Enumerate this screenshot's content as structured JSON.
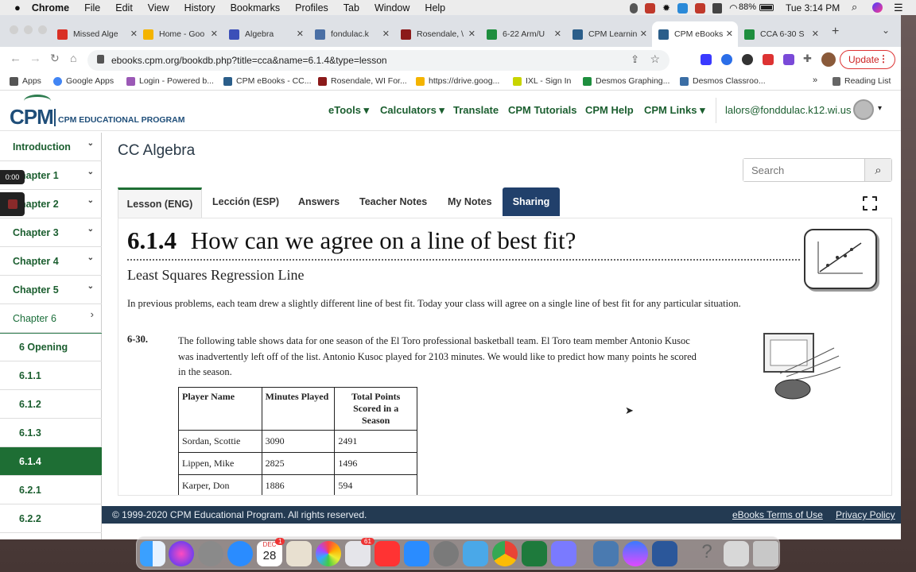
{
  "menubar": {
    "apple": "",
    "app": "Chrome",
    "menus": [
      "File",
      "Edit",
      "View",
      "History",
      "Bookmarks",
      "Profiles",
      "Tab",
      "Window",
      "Help"
    ],
    "battery": "88%",
    "clock": "Tue 3:14 PM"
  },
  "tabs": [
    {
      "label": "Missed Alge",
      "color": "#d93025"
    },
    {
      "label": "Home - Goo",
      "color": "#f4b400"
    },
    {
      "label": "Algebra",
      "color": "#3c4fb8"
    },
    {
      "label": "fondulac.k",
      "color": "#4a6fa5"
    },
    {
      "label": "Rosendale, \\",
      "color": "#8b1a1a"
    },
    {
      "label": "6-22 Arm/U",
      "color": "#1e8e3e"
    },
    {
      "label": "CPM Learnin",
      "color": "#2b5e8a"
    },
    {
      "label": "CPM eBooks",
      "color": "#2b5e8a"
    },
    {
      "label": "CCA 6-30 S",
      "color": "#1e8e3e"
    }
  ],
  "new_tab": "+",
  "address": {
    "url": "ebooks.cpm.org/bookdb.php?title=cca&name=6.1.4&type=lesson",
    "update_label": "Update"
  },
  "bookmarks": [
    {
      "label": "Apps",
      "color": "#555"
    },
    {
      "label": "Google Apps",
      "color": "#4285f4"
    },
    {
      "label": "Login - Powered b...",
      "color": "#9b59b6"
    },
    {
      "label": "CPM eBooks - CC...",
      "color": "#2b5e8a"
    },
    {
      "label": "Rosendale, WI For...",
      "color": "#8b1a1a"
    },
    {
      "label": "https://drive.goog...",
      "color": "#f4b400"
    },
    {
      "label": "IXL - Sign In",
      "color": "#c8d400"
    },
    {
      "label": "Desmos Graphing...",
      "color": "#1e8e3e"
    },
    {
      "label": "Desmos Classroo...",
      "color": "#3b6ea5"
    }
  ],
  "reading_list": "Reading List",
  "header": {
    "logo_big": "CPM",
    "logo_small": "CPM EDUCATIONAL PROGRAM",
    "nav": [
      "eTools",
      "Calculators",
      "Translate",
      "CPM Tutorials",
      "CPM Help",
      "CPM Links"
    ],
    "user": "lalors@fonddulac.k12.wi.us"
  },
  "sidebar": [
    {
      "label": "Introduction",
      "caret": "⌄"
    },
    {
      "label": "Chapter 1",
      "caret": "⌄"
    },
    {
      "label": "Chapter 2",
      "caret": "⌄"
    },
    {
      "label": "Chapter 3",
      "caret": "⌄"
    },
    {
      "label": "Chapter 4",
      "caret": "⌄"
    },
    {
      "label": "Chapter 5",
      "caret": "⌄"
    },
    {
      "label": "Chapter 6",
      "caret": "›"
    },
    {
      "label": "6 Opening"
    },
    {
      "label": "6.1.1"
    },
    {
      "label": "6.1.2"
    },
    {
      "label": "6.1.3"
    },
    {
      "label": "6.1.4"
    },
    {
      "label": "6.2.1"
    },
    {
      "label": "6.2.2"
    }
  ],
  "recorder": {
    "time": "0:00"
  },
  "course_title": "CC Algebra",
  "search": {
    "placeholder": "Search"
  },
  "content_tabs": [
    "Lesson (ENG)",
    "Lección (ESP)",
    "Answers",
    "Teacher Notes",
    "My Notes",
    "Sharing"
  ],
  "lesson": {
    "number": "6.1.4",
    "title": "How can we agree on a line of best fit?",
    "subtitle": "Least Squares Regression Line",
    "intro": "In previous problems, each team drew a slightly different line of best fit. Today your class will agree on a single line of best fit for any particular situation.",
    "problem_num": "6-30.",
    "problem_text": "The following table shows data for one season of the El Toro professional basketball team. El Toro team member Antonio Kusoc was inadvertently left off of the list. Antonio Kusoc played for 2103 minutes. We would like to predict how many points he scored in the season.",
    "table_headers": [
      "Player Name",
      "Minutes Played",
      "Total Points Scored in a Season"
    ],
    "table_rows": [
      [
        "Sordan, Scottie",
        "3090",
        "2491"
      ],
      [
        "Lippen, Mike",
        "2825",
        "1496"
      ],
      [
        "Karper, Don",
        "1886",
        "594"
      ]
    ]
  },
  "footer": {
    "copyright": "© 1999-2020 CPM Educational Program. All rights reserved.",
    "terms": "eBooks Terms of Use",
    "privacy": "Privacy Policy"
  },
  "dock": {
    "calendar_month": "DEC",
    "calendar_day": "28",
    "mail_badge": "61",
    "calendar_badge": "1"
  }
}
